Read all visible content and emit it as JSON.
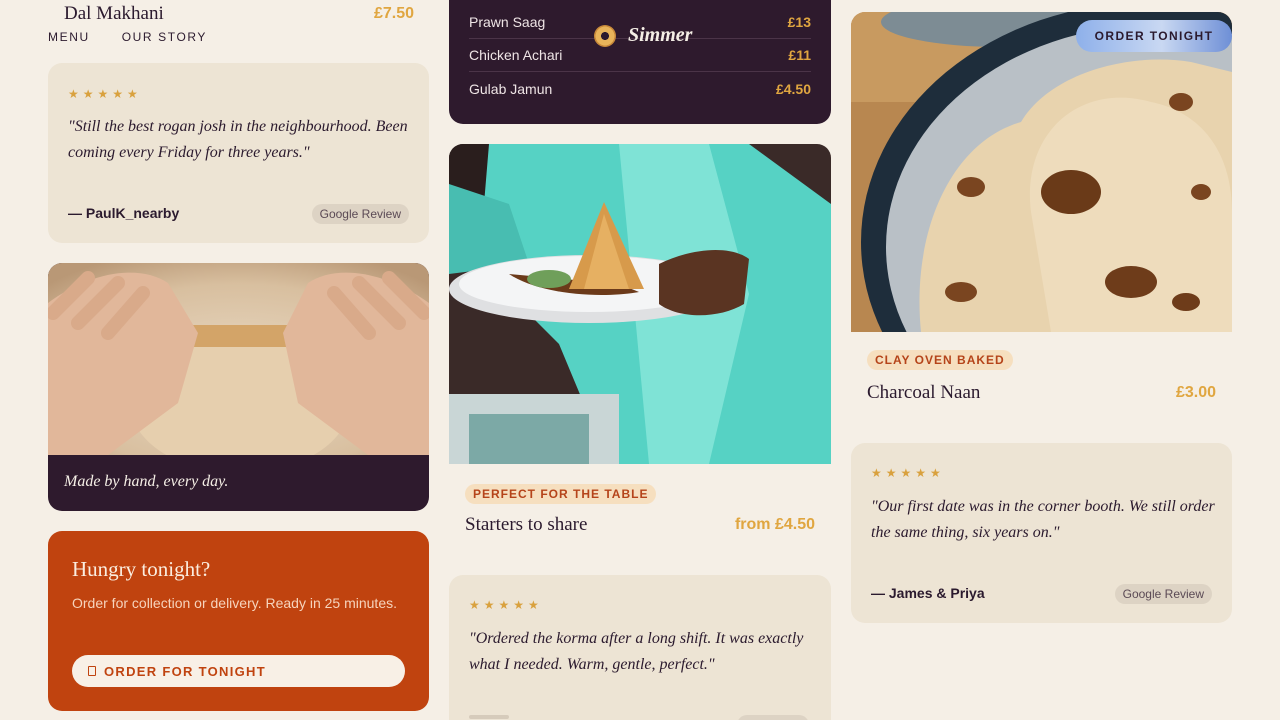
{
  "header": {
    "nav": [
      "MENU",
      "OUR STORY"
    ],
    "brand": "Simmer",
    "order_button": "ORDER TONIGHT"
  },
  "top_item": {
    "name": "Dal Makhani",
    "price": "£7.50"
  },
  "menu_list": [
    {
      "name": "Prawn Saag",
      "price": "£13"
    },
    {
      "name": "Chicken Achari",
      "price": "£11"
    },
    {
      "name": "Gulab Jamun",
      "price": "£4.50"
    }
  ],
  "reviews": [
    {
      "stars": "★★★★★",
      "quote": "\"Still the best rogan josh in the neighbourhood. Been coming every Friday for three years.\"",
      "author": "— PaulK_nearby",
      "source": "Google Review"
    },
    {
      "stars": "★★★★★",
      "quote": "\"Our first date was in the corner booth. We still order the same thing, six years on.\"",
      "author": "— James & Priya",
      "source": "Google Review"
    },
    {
      "stars": "★★★★★",
      "quote": "\"Ordered the korma after a long shift. It was exactly what I needed. Warm, gentle, perfect.\""
    }
  ],
  "hand_card": {
    "caption": "Made by hand, every day."
  },
  "starters": {
    "tag": "PERFECT FOR THE TABLE",
    "name": "Starters to share",
    "price": "from £4.50"
  },
  "naan": {
    "tag": "CLAY OVEN BAKED",
    "name": "Charcoal Naan",
    "price": "£3.00"
  },
  "cta": {
    "title": "Hungry tonight?",
    "text": "Order for collection or delivery. Ready in 25 minutes.",
    "button": "ORDER FOR TONIGHT"
  },
  "colors": {
    "accent": "#e0a640",
    "dark": "#2e1a2d",
    "cta": "#c0430f",
    "card": "#ede4d4",
    "background": "#f5efe6"
  }
}
